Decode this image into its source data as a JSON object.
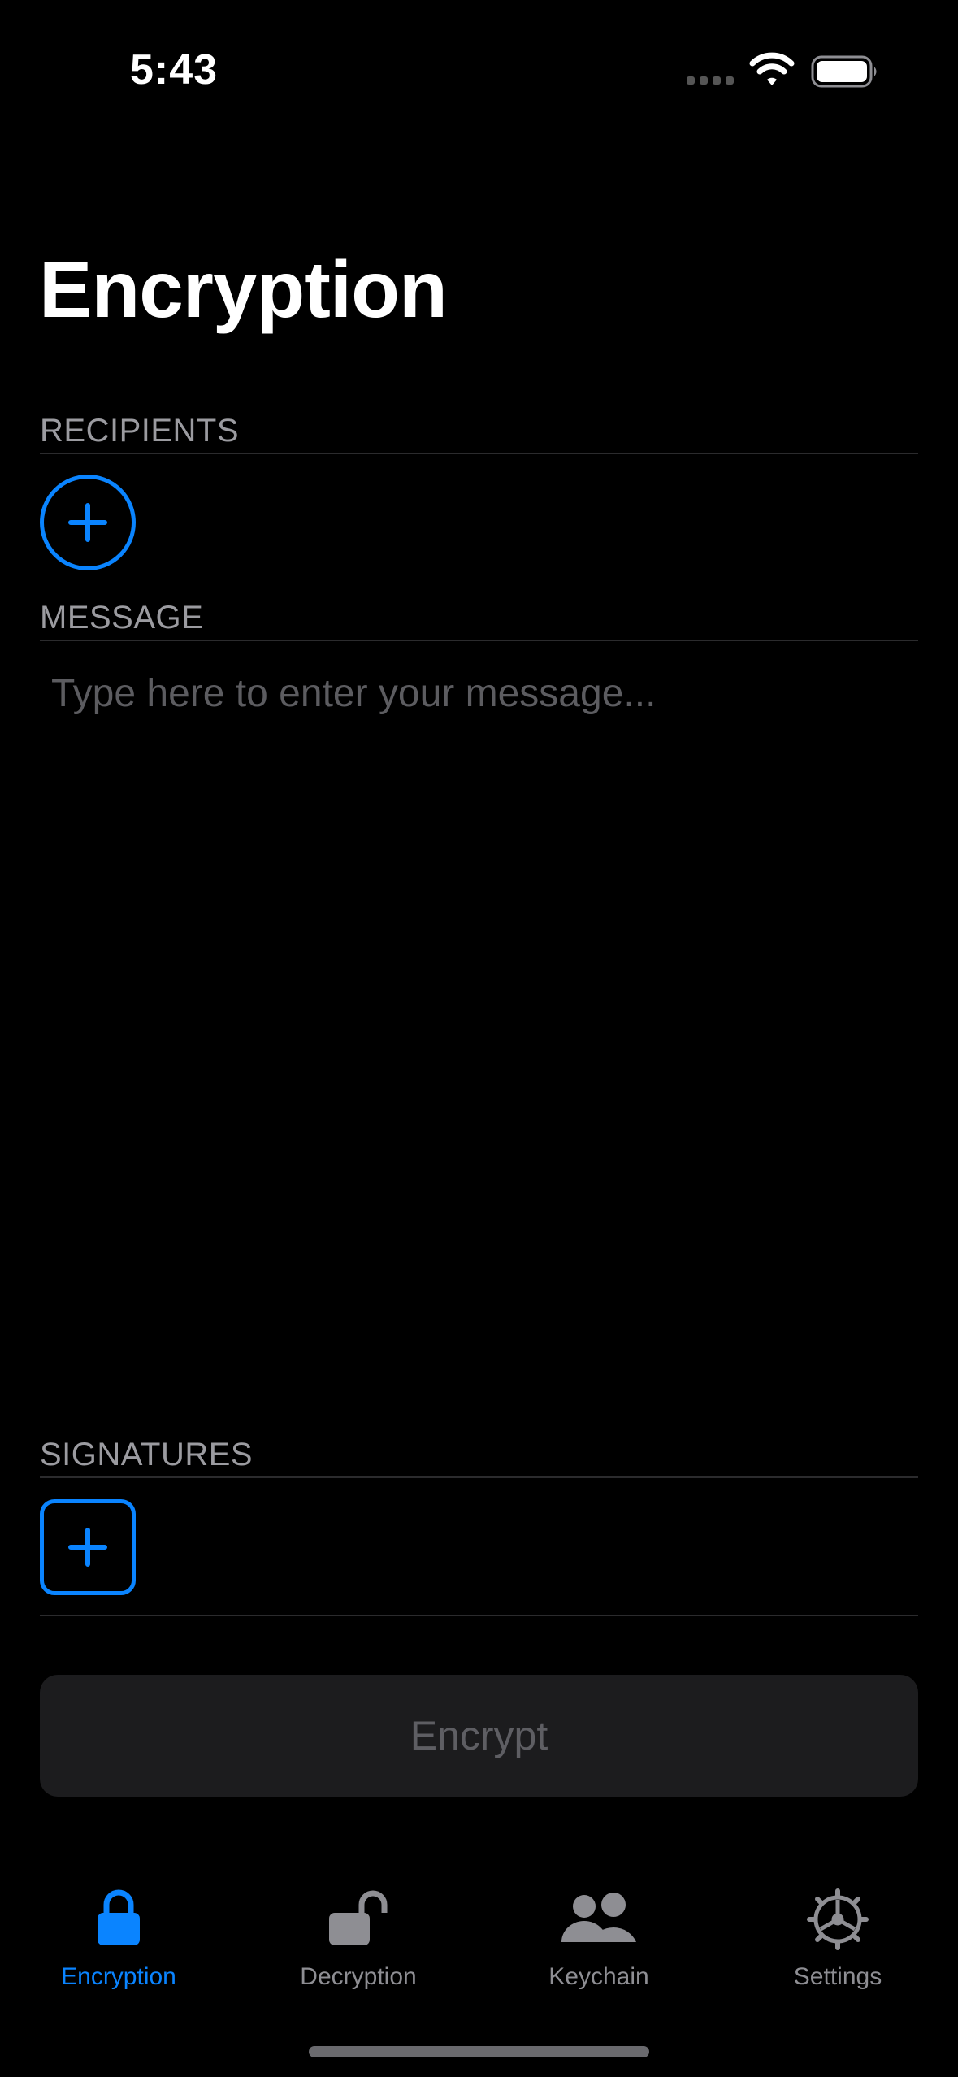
{
  "status_bar": {
    "time": "5:43"
  },
  "page": {
    "title": "Encryption"
  },
  "recipients": {
    "label": "RECIPIENTS"
  },
  "message": {
    "label": "MESSAGE",
    "placeholder": "Type here to enter your message...",
    "value": ""
  },
  "signatures": {
    "label": "SIGNATURES"
  },
  "actions": {
    "encrypt_label": "Encrypt"
  },
  "tabs": [
    {
      "label": "Encryption",
      "icon": "lock-icon",
      "active": true
    },
    {
      "label": "Decryption",
      "icon": "unlock-icon",
      "active": false
    },
    {
      "label": "Keychain",
      "icon": "people-icon",
      "active": false
    },
    {
      "label": "Settings",
      "icon": "gear-icon",
      "active": false
    }
  ],
  "colors": {
    "accent": "#0a84ff",
    "background": "#000000",
    "inactive": "#8e8e93",
    "button_bg": "#1c1c1e"
  }
}
